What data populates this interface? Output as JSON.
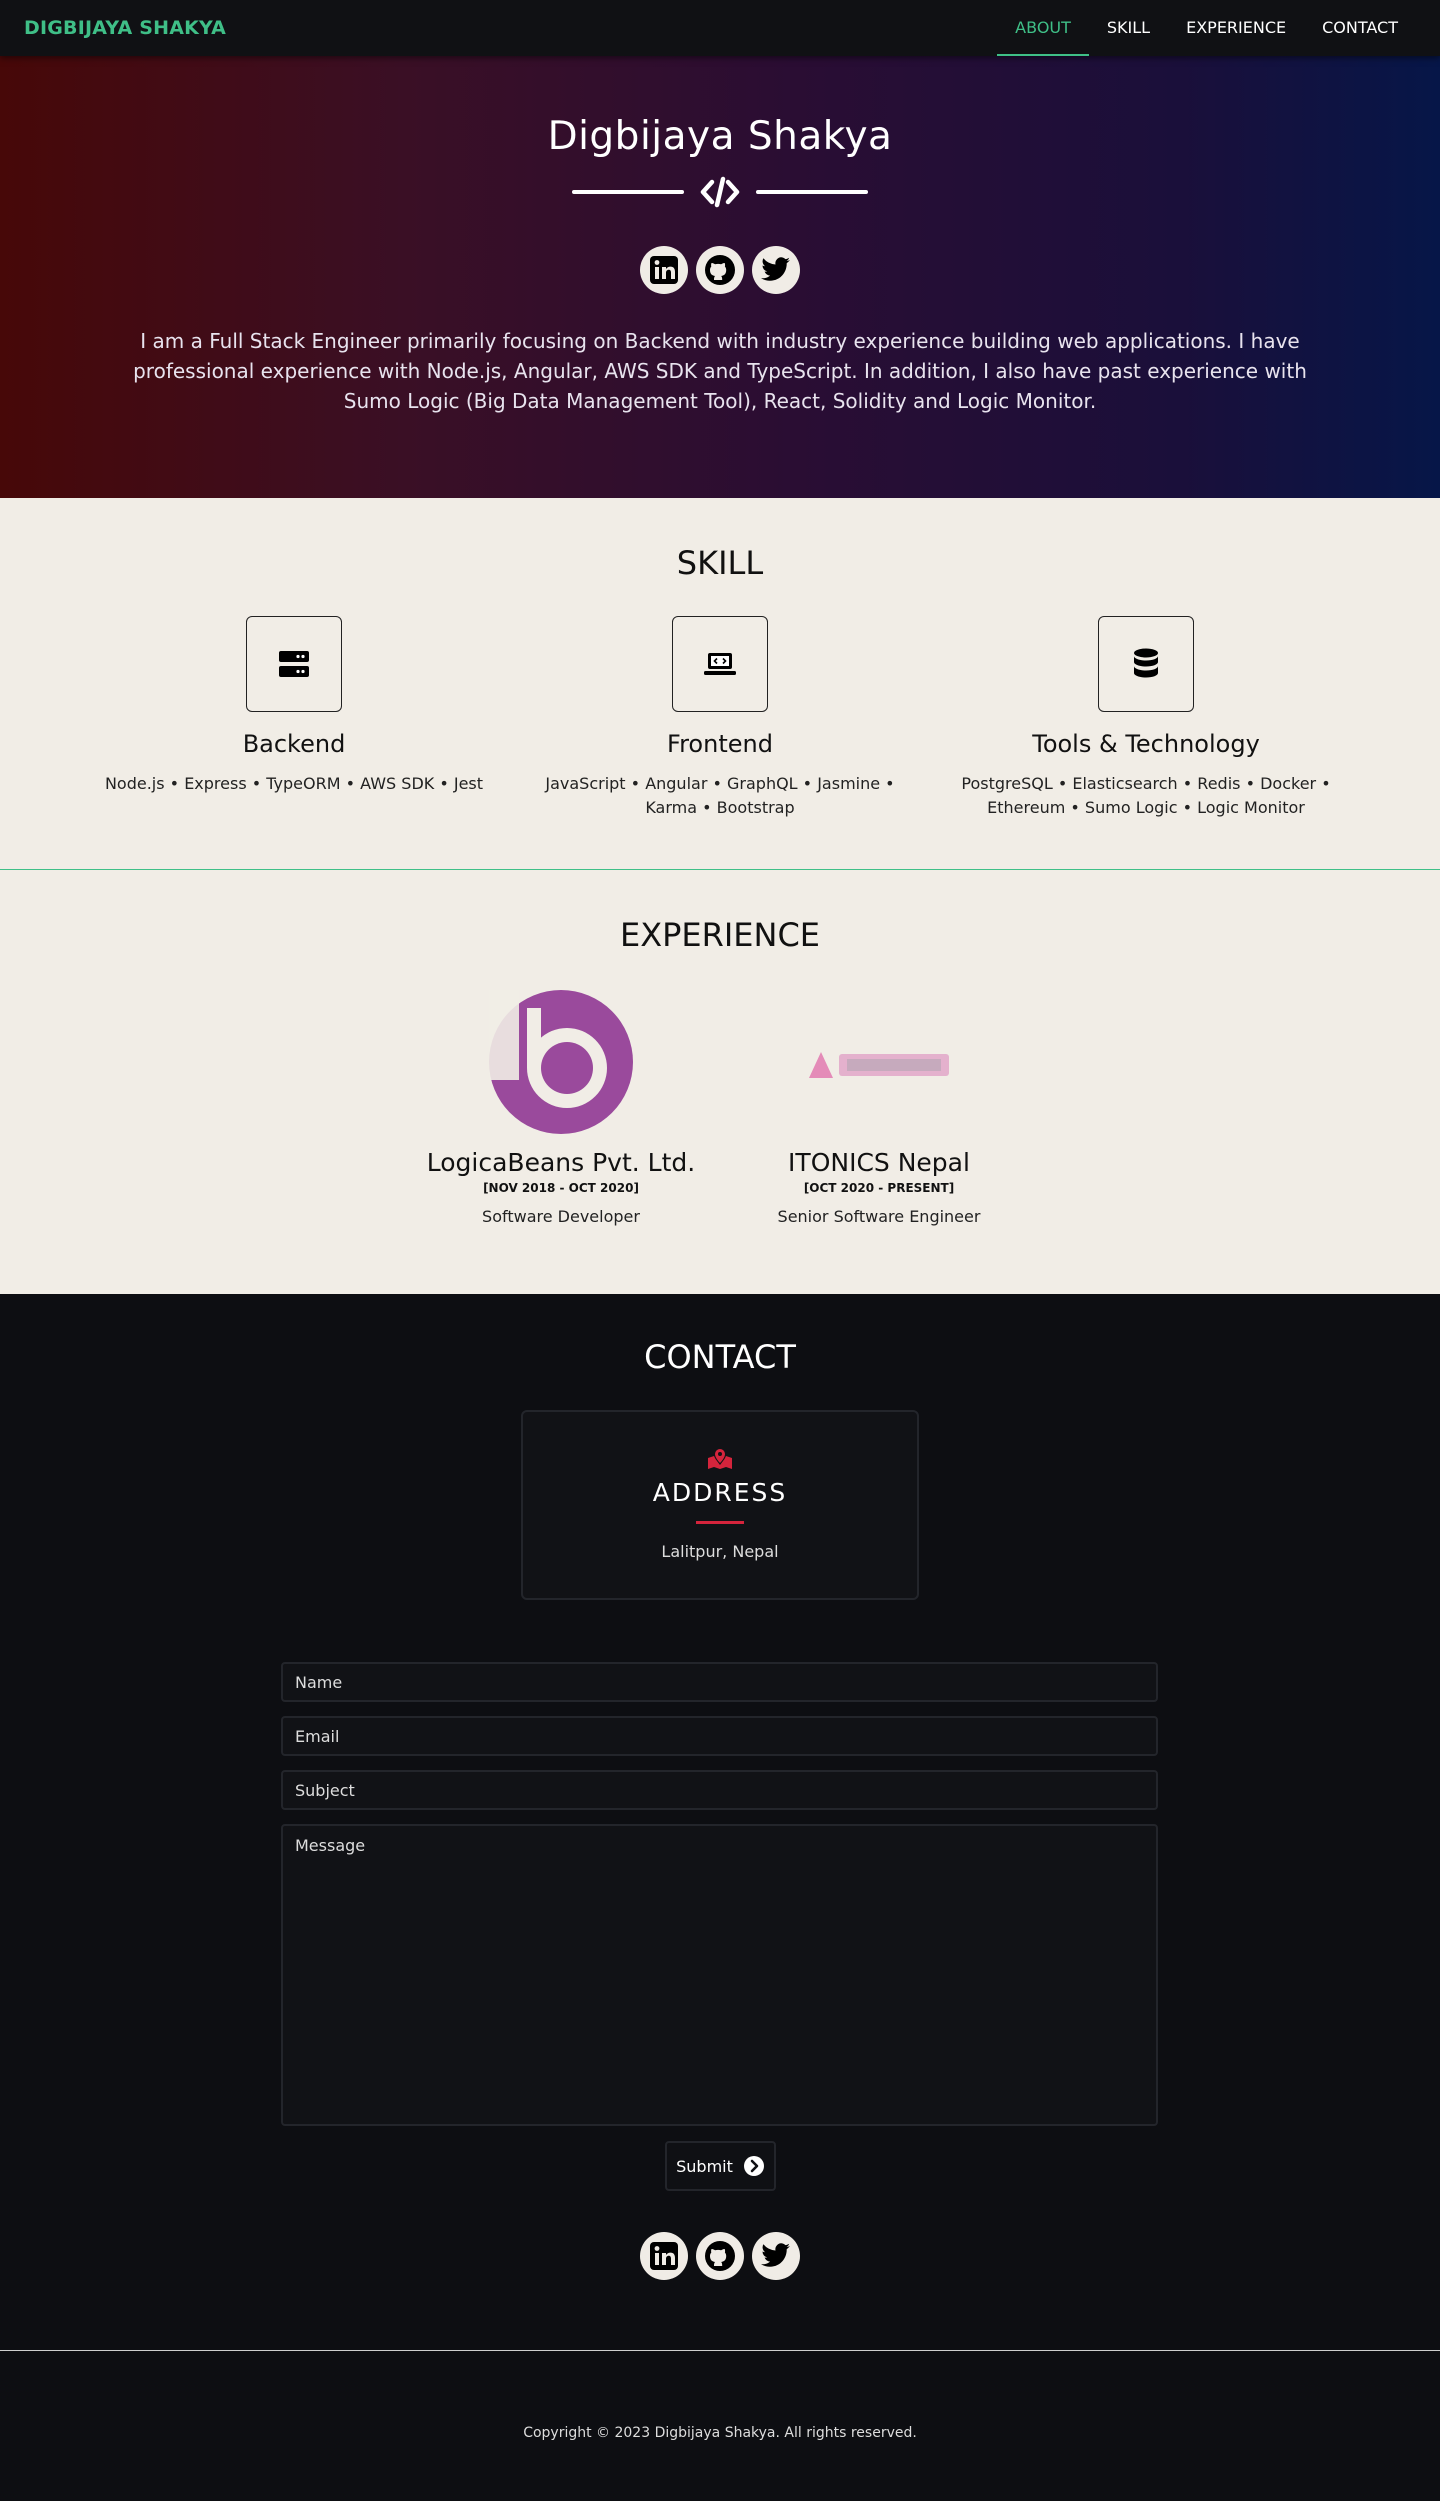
{
  "nav": {
    "brand": "DIGBIJAYA SHAKYA",
    "links": [
      {
        "label": "ABOUT",
        "active": true
      },
      {
        "label": "SKILL",
        "active": false
      },
      {
        "label": "EXPERIENCE",
        "active": false
      },
      {
        "label": "CONTACT",
        "active": false
      }
    ]
  },
  "hero": {
    "name": "Digbijaya Shakya",
    "divider_icon": "code-icon",
    "socials": [
      "linkedin-icon",
      "github-icon",
      "twitter-icon"
    ],
    "bio": "I am a Full Stack Engineer primarily focusing on Backend with industry experience building web applications. I have professional experience with Node.js, Angular, AWS SDK and TypeScript. In addition, I also have past experience with Sumo Logic (Big Data Management Tool), React, Solidity and Logic Monitor."
  },
  "skill": {
    "title": "SKILL",
    "columns": [
      {
        "icon": "server-icon",
        "title": "Backend",
        "items": "Node.js • Express • TypeORM • AWS SDK • Jest"
      },
      {
        "icon": "laptop-code-icon",
        "title": "Frontend",
        "items": "JavaScript • Angular • GraphQL • Jasmine • Karma • Bootstrap"
      },
      {
        "icon": "database-icon",
        "title": "Tools & Technology",
        "items": "PostgreSQL • Elasticsearch • Redis • Docker • Ethereum • Sumo Logic • Logic Monitor"
      }
    ]
  },
  "experience": {
    "title": "EXPERIENCE",
    "jobs": [
      {
        "company": "LogicaBeans Pvt. Ltd.",
        "dates": "[NOV 2018 - OCT 2020]",
        "role": "Software Developer",
        "logo_color": "#9a4a9c"
      },
      {
        "company": "ITONICS Nepal",
        "dates": "[OCT 2020 - PRESENT]",
        "role": "Senior Software Engineer",
        "logo_color": "#e48bb8"
      }
    ]
  },
  "contact": {
    "title": "CONTACT",
    "address_icon": "map-marker-icon",
    "address_title": "ADDRESS",
    "address_value": "Lalitpur, Nepal",
    "form": {
      "name_placeholder": "Name",
      "email_placeholder": "Email",
      "subject_placeholder": "Subject",
      "message_placeholder": "Message",
      "submit_label": "Submit"
    },
    "socials": [
      "linkedin-icon",
      "github-icon",
      "twitter-icon"
    ]
  },
  "footer": {
    "copyright": "Copyright © 2023 Digbijaya Shakya. All rights reserved."
  },
  "colors": {
    "accent": "#3fbf87",
    "address_red": "#d5243c",
    "dark_bg": "#0d0e12",
    "light_bg": "#f1ede6"
  }
}
